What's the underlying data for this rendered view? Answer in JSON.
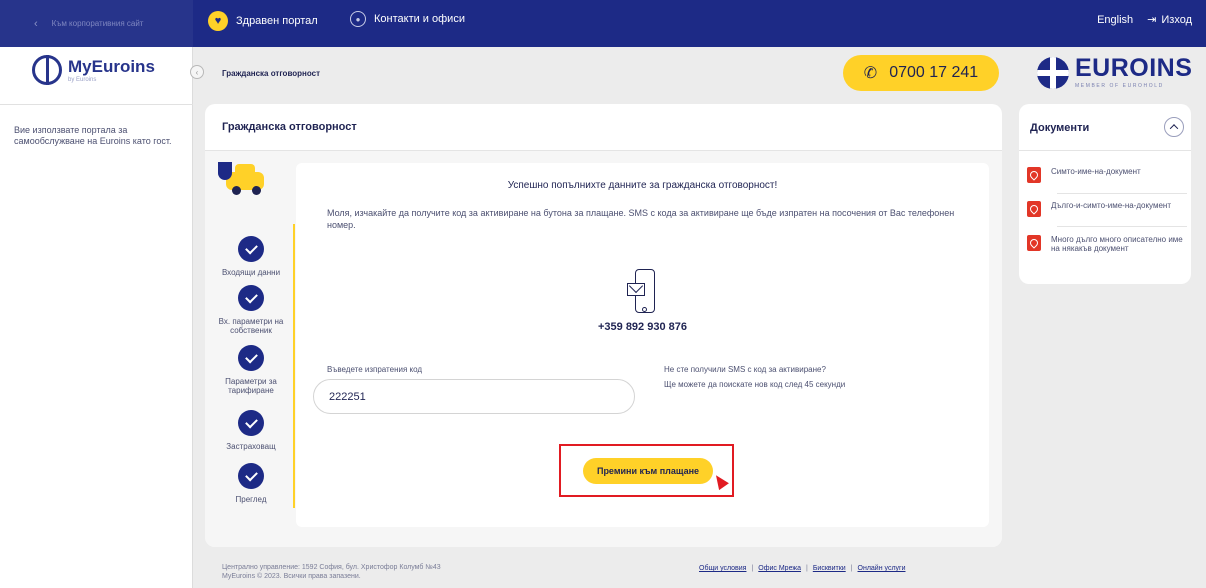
{
  "topbar": {
    "back_label": "Към корпоративния сайт",
    "health_portal": "Здравен портал",
    "contacts": "Контакти и офиси",
    "language": "English",
    "logout": "Изход"
  },
  "sidebar": {
    "logo_text": "MyEuroins",
    "logo_sub": "by Euroins",
    "intro_text": "Вие използвате портала за самообслужване на Euroins като гост."
  },
  "header": {
    "breadcrumb": "Гражданска отговорност",
    "phone": "0700 17 241",
    "brand": "EUROINS",
    "brand_sub": "MEMBER OF EUROHOLD"
  },
  "main": {
    "title": "Гражданска отговорност",
    "steps": [
      {
        "label": "Входящи данни"
      },
      {
        "label": "Вх. параметри на собственик"
      },
      {
        "label": "Параметри за тарифиране"
      },
      {
        "label": "Застраховащ"
      },
      {
        "label": "Преглед"
      }
    ],
    "success_message": "Успешно попълнихте данните за гражданска отговорност!",
    "instructions": "Моля, изчакайте да получите код за активиране на бутона за плащане. SMS с кода за активиране ще бъде изпратен на посочения от Вас телефонен номер.",
    "phone_number": "+359 892 930 876",
    "code_label": "Въведете изпратения код",
    "code_value": "222251",
    "resend_question": "Не сте получили SMS с код за активиране?",
    "resend_text": "Ще можете да поискате нов код след 45 секунди",
    "pay_button": "Премини към плащане"
  },
  "documents": {
    "title": "Документи",
    "items": [
      {
        "name": "Симто-име-на-документ"
      },
      {
        "name": "Дълго-и-симто-име-на-документ"
      },
      {
        "name": "Много дълго много описателно име на някакъв документ"
      }
    ]
  },
  "footer": {
    "address": "Централно управление: 1592 София, бул. Христофор Колумб №43",
    "copyright": "MyEuroins © 2023. Всички права запазени.",
    "links": [
      "Общи условия",
      "Офис Мрежа",
      "Бисквитки",
      "Онлайн услуги"
    ]
  },
  "colors": {
    "accent": "#ffd128",
    "brand": "#1d2a86",
    "highlight": "#e11b22"
  }
}
